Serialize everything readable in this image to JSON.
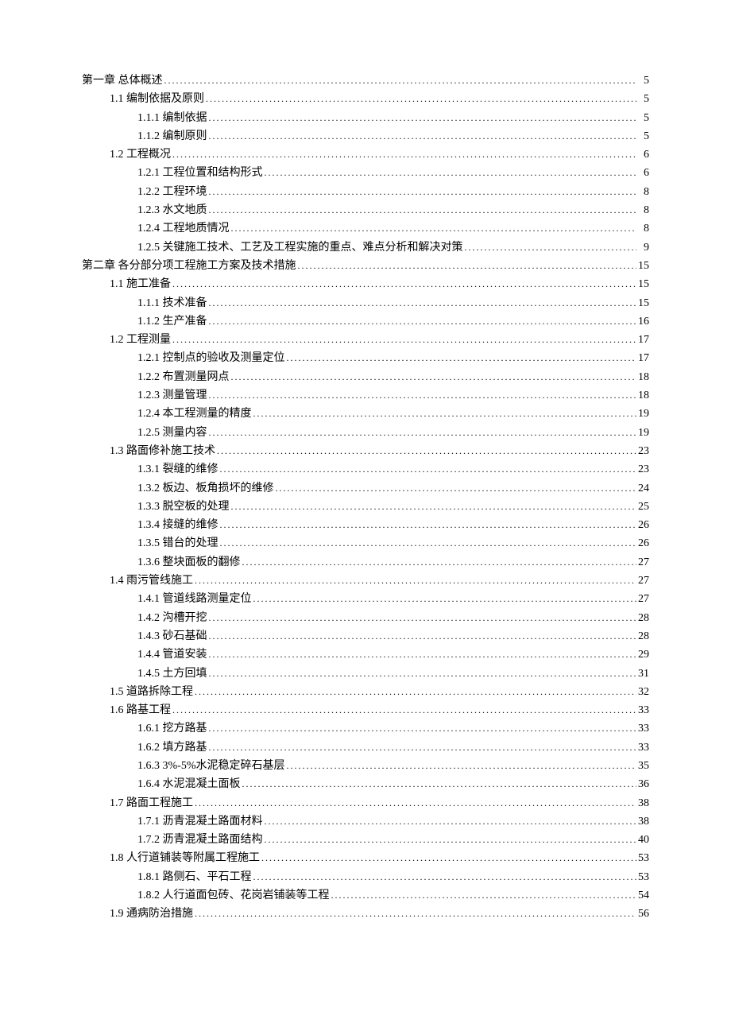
{
  "toc": [
    {
      "level": 1,
      "title": "第一章 总体概述",
      "page": "5"
    },
    {
      "level": 2,
      "title": "1.1 编制依据及原则",
      "page": "5"
    },
    {
      "level": 3,
      "title": "1.1.1 编制依据",
      "page": "5"
    },
    {
      "level": 3,
      "title": "1.1.2 编制原则",
      "page": "5"
    },
    {
      "level": 2,
      "title": "1.2 工程概况",
      "page": "6"
    },
    {
      "level": 3,
      "title": "1.2.1 工程位置和结构形式",
      "page": "6"
    },
    {
      "level": 3,
      "title": "1.2.2 工程环境",
      "page": "8"
    },
    {
      "level": 3,
      "title": "1.2.3 水文地质",
      "page": "8"
    },
    {
      "level": 3,
      "title": "1.2.4 工程地质情况",
      "page": "8"
    },
    {
      "level": 3,
      "title": "1.2.5 关键施工技术、工艺及工程实施的重点、难点分析和解决对策",
      "page": "9"
    },
    {
      "level": 1,
      "title": "第二章 各分部分项工程施工方案及技术措施",
      "page": "15"
    },
    {
      "level": 2,
      "title": "1.1 施工准备",
      "page": "15"
    },
    {
      "level": 3,
      "title": "1.1.1 技术准备",
      "page": "15"
    },
    {
      "level": 3,
      "title": "1.1.2 生产准备",
      "page": "16"
    },
    {
      "level": 2,
      "title": "1.2 工程测量",
      "page": "17"
    },
    {
      "level": 3,
      "title": "1.2.1 控制点的验收及测量定位",
      "page": "17"
    },
    {
      "level": 3,
      "title": "1.2.2 布置测量网点",
      "page": "18"
    },
    {
      "level": 3,
      "title": "1.2.3 测量管理",
      "page": "18"
    },
    {
      "level": 3,
      "title": "1.2.4 本工程测量的精度",
      "page": "19"
    },
    {
      "level": 3,
      "title": "1.2.5 测量内容",
      "page": "19"
    },
    {
      "level": 2,
      "title": "1.3 路面修补施工技术",
      "page": "23"
    },
    {
      "level": 3,
      "title": "1.3.1 裂缝的维修",
      "page": "23"
    },
    {
      "level": 3,
      "title": "1.3.2 板边、板角损坏的维修",
      "page": "24"
    },
    {
      "level": 3,
      "title": "1.3.3 脱空板的处理",
      "page": "25"
    },
    {
      "level": 3,
      "title": "1.3.4 接缝的维修",
      "page": "26"
    },
    {
      "level": 3,
      "title": "1.3.5 错台的处理",
      "page": "26"
    },
    {
      "level": 3,
      "title": "1.3.6 整块面板的翻修",
      "page": "27"
    },
    {
      "level": 2,
      "title": "1.4 雨污管线施工",
      "page": "27"
    },
    {
      "level": 3,
      "title": "1.4.1 管道线路测量定位",
      "page": "27"
    },
    {
      "level": 3,
      "title": "1.4.2 沟槽开挖",
      "page": "28"
    },
    {
      "level": 3,
      "title": "1.4.3 砂石基础",
      "page": "28"
    },
    {
      "level": 3,
      "title": "1.4.4 管道安装",
      "page": "29"
    },
    {
      "level": 3,
      "title": "1.4.5 土方回填",
      "page": "31"
    },
    {
      "level": 2,
      "title": "1.5 道路拆除工程",
      "page": "32"
    },
    {
      "level": 2,
      "title": "1.6 路基工程",
      "page": "33"
    },
    {
      "level": 3,
      "title": "1.6.1 挖方路基",
      "page": "33"
    },
    {
      "level": 3,
      "title": "1.6.2 填方路基",
      "page": "33"
    },
    {
      "level": 3,
      "title": "1.6.3 3%-5%水泥稳定碎石基层",
      "page": "35"
    },
    {
      "level": 3,
      "title": "1.6.4 水泥混凝土面板",
      "page": "36"
    },
    {
      "level": 2,
      "title": "1.7 路面工程施工",
      "page": "38"
    },
    {
      "level": 3,
      "title": "1.7.1 沥青混凝土路面材料",
      "page": "38"
    },
    {
      "level": 3,
      "title": "1.7.2 沥青混凝土路面结构",
      "page": "40"
    },
    {
      "level": 2,
      "title": "1.8 人行道铺装等附属工程施工",
      "page": "53"
    },
    {
      "level": 3,
      "title": "1.8.1 路侧石、平石工程",
      "page": "53"
    },
    {
      "level": 3,
      "title": "1.8.2 人行道面包砖、花岗岩铺装等工程",
      "page": "54"
    },
    {
      "level": 2,
      "title": "1.9 通病防治措施",
      "page": "56"
    }
  ]
}
